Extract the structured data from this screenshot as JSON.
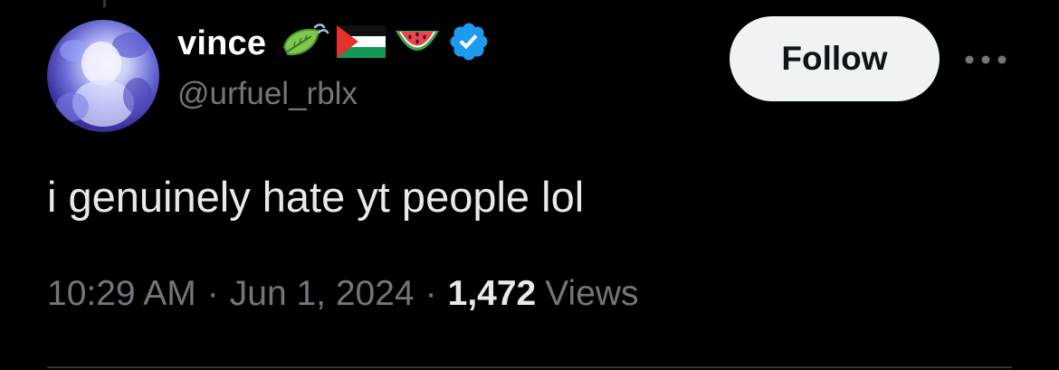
{
  "tweet": {
    "author": {
      "display_name": "vince",
      "handle": "@urfuel_rblx",
      "avatar": "avatar-image",
      "name_emojis": [
        "leaf-fluttering-in-wind-icon",
        "palestine-flag-icon",
        "watermelon-icon"
      ],
      "badge": "verified-badge-icon"
    },
    "follow_label": "Follow",
    "more_icon": "more-options-icon",
    "text": "i genuinely hate yt people lol",
    "time": "10:29 AM",
    "date": "Jun 1, 2024",
    "separator": "·",
    "views_count": "1,472",
    "views_label": "Views"
  },
  "colors": {
    "background": "#000000",
    "primary_text": "#e7e9ea",
    "secondary_text": "#71767b",
    "verified_blue": "#1d9bf0",
    "follow_button_bg": "#eff3f4",
    "follow_button_text": "#0f1419",
    "divider": "#2f3336"
  }
}
